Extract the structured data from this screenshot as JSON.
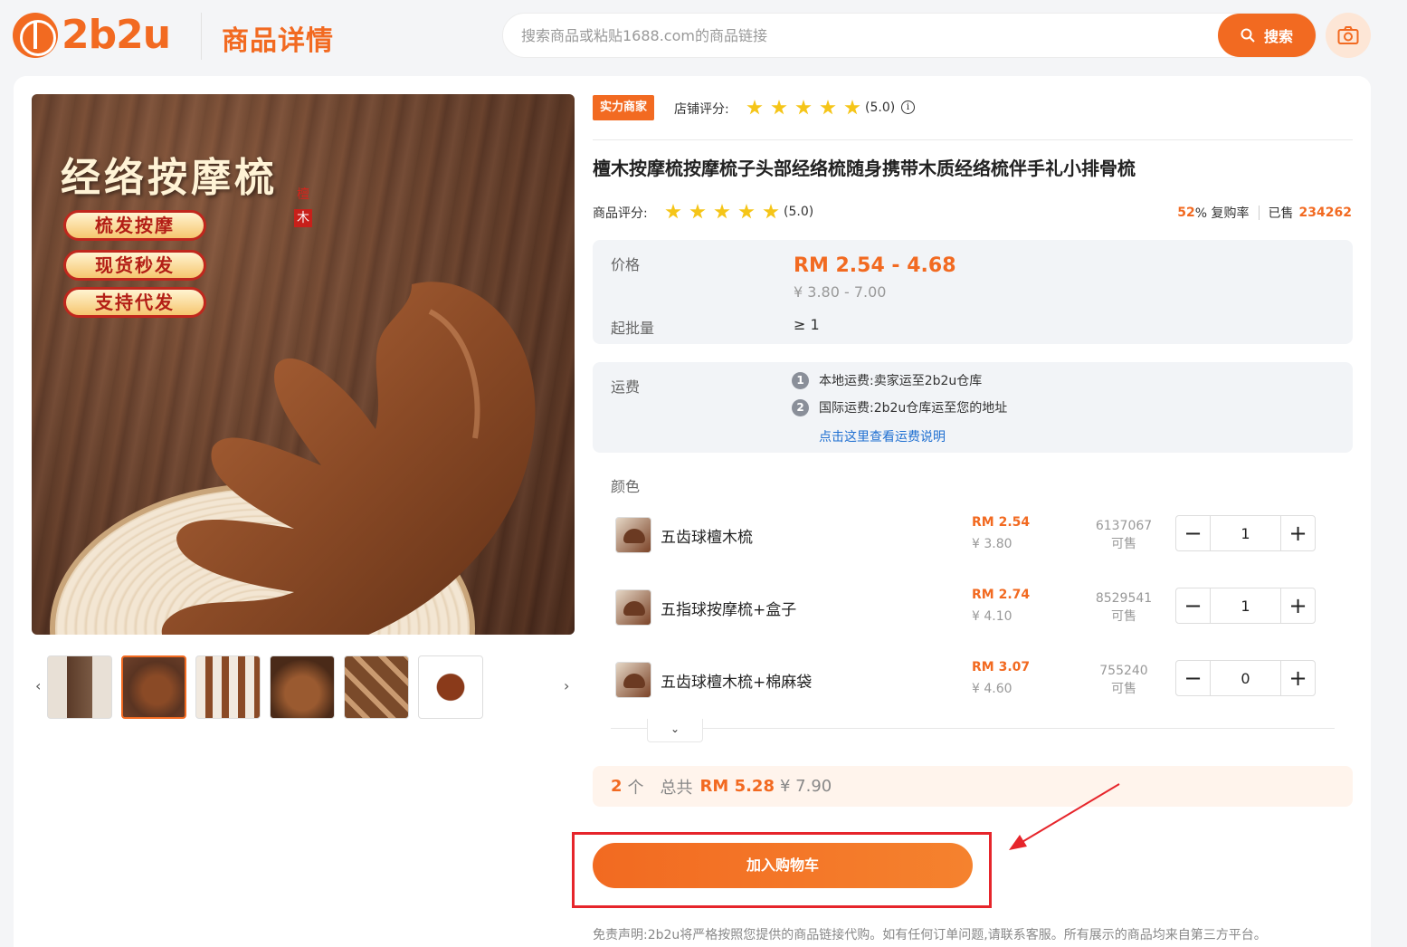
{
  "header": {
    "logo_text": "2b2u",
    "page_title": "商品详情",
    "search_placeholder": "搜索商品或粘贴1688.com的商品链接",
    "search_button": "搜索"
  },
  "gallery": {
    "main_image": {
      "title": "经络按摩梳",
      "seal_chars": [
        "檀",
        "木"
      ],
      "tags": [
        "梳发按摩",
        "现货秒发",
        "支持代发"
      ]
    },
    "thumbnails_count": 6,
    "active_thumbnail": 2,
    "prev_arrow": "‹",
    "next_arrow": "›"
  },
  "product": {
    "shop_badge": "实力商家",
    "shop_rating_label": "店铺评分:",
    "shop_rating_value": "(5.0)",
    "shop_rating_stars": 5,
    "title": "檀木按摩梳按摩梳子头部经络梳随身携带木质经络梳伴手礼小排骨梳",
    "goods_rating_label": "商品评分:",
    "goods_rating_value": "(5.0)",
    "goods_rating_stars": 5,
    "repurchase_rate": "52",
    "repurchase_suffix": "% 复购率",
    "sold_label": "已售",
    "sold_count": "234262"
  },
  "price": {
    "label": "价格",
    "rm_range": "RM 2.54 - 4.68",
    "cny_range": "¥ 3.80 - 7.00",
    "moq_label": "起批量",
    "moq_value": "≥ 1"
  },
  "shipping": {
    "label": "运费",
    "steps": [
      {
        "num": "1",
        "text": "本地运费:卖家运至2b2u仓库"
      },
      {
        "num": "2",
        "text": "国际运费:2b2u仓库运至您的地址"
      }
    ],
    "link_text": "点击这里查看运费说明"
  },
  "variants": {
    "label": "颜色",
    "items": [
      {
        "name": "五齿球檀木梳",
        "price_rm": "RM 2.54",
        "price_cny": "¥ 3.80",
        "stock": "6137067",
        "stock_label": "可售",
        "qty": "1"
      },
      {
        "name": "五指球按摩梳+盒子",
        "price_rm": "RM 2.74",
        "price_cny": "¥ 4.10",
        "stock": "8529541",
        "stock_label": "可售",
        "qty": "1"
      },
      {
        "name": "五齿球檀木梳+棉麻袋",
        "price_rm": "RM 3.07",
        "price_cny": "¥ 4.60",
        "stock": "755240",
        "stock_label": "可售",
        "qty": "0"
      }
    ],
    "minus": "−",
    "plus": "+",
    "expand": "⌄"
  },
  "summary": {
    "count": "2",
    "count_unit": "个",
    "total_label": "总共",
    "total_rm": "RM 5.28",
    "total_cny": "¥ 7.90"
  },
  "cart": {
    "button": "加入购物车"
  },
  "disclaimer": "免责声明:2b2u将严格按照您提供的商品链接代购。如有任何订单问题,请联系客服。所有展示的商品均来自第三方平台。",
  "colors": {
    "accent": "#f26a21",
    "highlight": "#e6252b",
    "link": "#1f6fd1"
  }
}
